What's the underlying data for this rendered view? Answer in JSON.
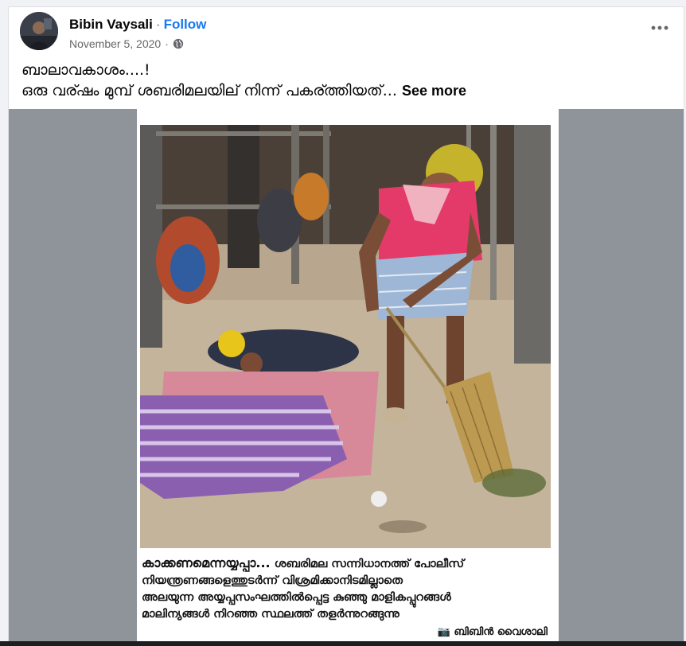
{
  "post": {
    "author": "Bibin Vaysali",
    "separator": "·",
    "follow_label": "Follow",
    "date": "November 5, 2020",
    "date_separator": "·",
    "privacy_icon": "globe-icon",
    "more_icon": "more-horizontal-icon",
    "text_line1": "ബാലാവകാശം....!",
    "text_line2": "ഒരു വര്ഷം മുമ്പ് ശബരിമലയില് നിന്ന് പകര്ത്തിയത്...",
    "see_more_label": "See more"
  },
  "image": {
    "caption_title": "കാക്കണമെന്നയ്യപ്പാ...",
    "caption_line1_rest": " ശബരിമല സന്നിധാനത്ത് പോലീസ്",
    "caption_line2": "നിയന്ത്രണങ്ങളെത്തുടർന്ന് വിശ്രമിക്കാനിടമില്ലാതെ",
    "caption_line3": "അലയുന്ന അയ്യപ്പസംഘത്തിൽപ്പെട്ട കുഞ്ഞു മാളികപ്പുറങ്ങൾ",
    "caption_line4": "മാലിന്യങ്ങൾ നിറഞ്ഞ സ്ഥലത്ത് തളർന്നുറങ്ങുന്നു",
    "credit": "ബിബിൻ വൈശാലി",
    "credit_icon": "camera-icon"
  },
  "colors": {
    "link_blue": "#1877f2",
    "meta_gray": "#65676b",
    "media_bg": "#8f949a"
  }
}
